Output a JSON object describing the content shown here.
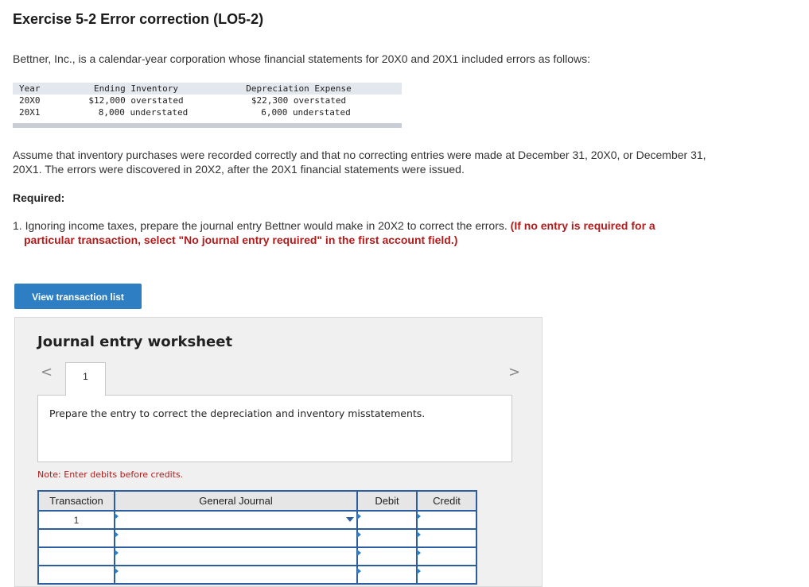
{
  "title": "Exercise 5-2 Error correction (LO5-2)",
  "intro": "Bettner, Inc., is a calendar-year corporation whose financial statements for 20X0 and 20X1 included errors as follows:",
  "errors_table": {
    "headers": [
      "Year",
      "Ending Inventory",
      "Depreciation Expense"
    ],
    "rows": [
      {
        "year": "20X0",
        "inventory": "$12,000 overstated",
        "depreciation": "$22,300 overstated"
      },
      {
        "year": "20X1",
        "inventory": "8,000 understated",
        "depreciation": "6,000 understated"
      }
    ]
  },
  "assumption": "Assume that inventory purchases were recorded correctly and that no correcting entries were made at December 31, 20X0, or December 31, 20X1. The errors were discovered in 20X2, after the 20X1 financial statements were issued.",
  "required_label": "Required:",
  "requirement_1": {
    "text": "1. Ignoring income taxes, prepare the journal entry Bettner would make in 20X2 to correct the errors.",
    "instruction_line1": "(If no entry is required for a",
    "instruction_line2": "particular transaction, select \"No journal entry required\" in the first account field.)"
  },
  "view_transaction_button": "View transaction list",
  "worksheet": {
    "title": "Journal entry worksheet",
    "nav_prev": "<",
    "nav_next": ">",
    "tabs": [
      {
        "label": "1",
        "active": true
      }
    ],
    "prompt": "Prepare the entry to correct the depreciation and inventory misstatements.",
    "note": "Note: Enter debits before credits.",
    "table": {
      "headers": [
        "Transaction",
        "General Journal",
        "Debit",
        "Credit"
      ],
      "rows": [
        {
          "transaction": "1",
          "account": "",
          "debit": "",
          "credit": ""
        },
        {
          "transaction": "",
          "account": "",
          "debit": "",
          "credit": ""
        },
        {
          "transaction": "",
          "account": "",
          "debit": "",
          "credit": ""
        },
        {
          "transaction": "",
          "account": "",
          "debit": "",
          "credit": ""
        }
      ]
    }
  }
}
